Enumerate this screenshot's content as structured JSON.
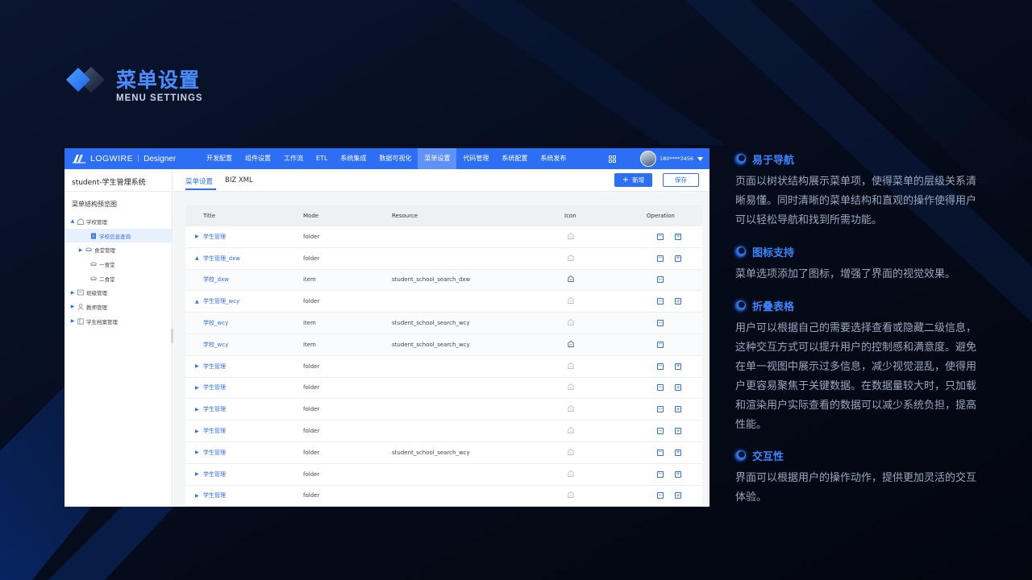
{
  "header": {
    "title": "菜单设置",
    "subtitle": "MENU SETTINGS"
  },
  "app": {
    "brand": "LOGWIRE",
    "brand_sep": "|",
    "brand_mode": "Designer",
    "nav": [
      {
        "label": "开发配置",
        "active": false
      },
      {
        "label": "组件设置",
        "active": false
      },
      {
        "label": "工作流",
        "active": false
      },
      {
        "label": "ETL",
        "active": false
      },
      {
        "label": "系统集成",
        "active": false
      },
      {
        "label": "数据可视化",
        "active": false
      },
      {
        "label": "菜单设置",
        "active": true
      },
      {
        "label": "代码管理",
        "active": false
      },
      {
        "label": "系统配置",
        "active": false
      },
      {
        "label": "系统发布",
        "active": false
      }
    ],
    "user": "180****3456",
    "sidebar": {
      "project": "student-学生管理系统",
      "tree_title": "菜单结构预览图",
      "items": [
        {
          "label": "学校管理",
          "caret": "▲",
          "icon": "building-icon",
          "selected": false
        },
        {
          "label": "学校信息查询",
          "caret": "",
          "icon": "document-icon",
          "selected": true
        },
        {
          "label": "食堂管理",
          "caret": "▶",
          "icon": "canteen-icon",
          "selected": false
        },
        {
          "label": "一食堂",
          "caret": "",
          "icon": "canteen-icon",
          "selected": false
        },
        {
          "label": "二食堂",
          "caret": "",
          "icon": "canteen-icon",
          "selected": false
        },
        {
          "label": "班级管理",
          "caret": "▶",
          "icon": "class-icon",
          "selected": false
        },
        {
          "label": "教师管理",
          "caret": "▶",
          "icon": "teacher-icon",
          "selected": false
        },
        {
          "label": "学生档案管理",
          "caret": "▶",
          "icon": "archive-icon",
          "selected": false
        }
      ]
    },
    "tabs": {
      "menu": "菜单设置",
      "biz": "BIZ XML"
    },
    "add_button": "新增",
    "add_symbol": "+",
    "save_button": "保存",
    "table": {
      "columns": {
        "title": "Title",
        "mode": "Mode",
        "resource": "Resource",
        "icon": "Icon",
        "operation": "Operation"
      },
      "rows": [
        {
          "title": "学生管理",
          "caret": "▶",
          "mode": "folder",
          "resource": "",
          "child": false,
          "icon_dark": false,
          "add": true
        },
        {
          "title": "学生管理_dxw",
          "caret": "▲",
          "mode": "folder",
          "resource": "",
          "child": false,
          "icon_dark": false,
          "add": true
        },
        {
          "title": "学校_dxw",
          "caret": "",
          "mode": "item",
          "resource": "student_school_search_dxw",
          "child": true,
          "icon_dark": true,
          "add": false
        },
        {
          "title": "学生管理_wcy",
          "caret": "▲",
          "mode": "folder",
          "resource": "",
          "child": false,
          "icon_dark": false,
          "add": true
        },
        {
          "title": "学校_wcy",
          "caret": "",
          "mode": "item",
          "resource": "student_school_search_wcy",
          "child": true,
          "icon_dark": false,
          "add": false
        },
        {
          "title": "学校_wcy",
          "caret": "",
          "mode": "item",
          "resource": "student_school_search_wcy",
          "child": true,
          "icon_dark": true,
          "add": false
        },
        {
          "title": "学生管理",
          "caret": "▶",
          "mode": "folder",
          "resource": "",
          "child": false,
          "icon_dark": false,
          "add": true
        },
        {
          "title": "学生管理",
          "caret": "▶",
          "mode": "folder",
          "resource": "",
          "child": false,
          "icon_dark": false,
          "add": true
        },
        {
          "title": "学生管理",
          "caret": "▶",
          "mode": "folder",
          "resource": "",
          "child": false,
          "icon_dark": false,
          "add": true
        },
        {
          "title": "学生管理",
          "caret": "▶",
          "mode": "folder",
          "resource": "",
          "child": false,
          "icon_dark": false,
          "add": true
        },
        {
          "title": "学生管理",
          "caret": "▶",
          "mode": "folder",
          "resource": "student_school_search_wcy",
          "child": false,
          "icon_dark": false,
          "add": true
        },
        {
          "title": "学生管理",
          "caret": "▶",
          "mode": "folder",
          "resource": "",
          "child": false,
          "icon_dark": false,
          "add": true
        },
        {
          "title": "学生管理",
          "caret": "▶",
          "mode": "folder",
          "resource": "",
          "child": false,
          "icon_dark": false,
          "add": true
        }
      ],
      "remove_symbol": "−",
      "add_symbol": "+"
    }
  },
  "features": [
    {
      "title": "易于导航",
      "body": "页面以树状结构展示菜单项，使得菜单的层级关系清晰易懂。同时清晰的菜单结构和直观的操作使得用户可以轻松导航和找到所需功能。"
    },
    {
      "title": "图标支持",
      "body": "菜单选项添加了图标，增强了界面的视觉效果。"
    },
    {
      "title": "折叠表格",
      "body": "用户可以根据自己的需要选择查看或隐藏二级信息，这种交互方式可以提升用户的控制感和满意度。避免在单一视图中展示过多信息，减少视觉混乱，使得用户更容易聚焦于关键数据。在数据量较大时，只加载和渲染用户实际查看的数据可以减少系统负担，提高性能。"
    },
    {
      "title": "交互性",
      "body": "界面可以根据用户的操作动作，提供更加灵活的交互体验。"
    }
  ],
  "colors": {
    "accent": "#2c6ff5",
    "title_blue": "#4a8dff",
    "feature_blue": "#3b86ff",
    "background": "#050c1c",
    "body_text": "#9ba7bd"
  }
}
